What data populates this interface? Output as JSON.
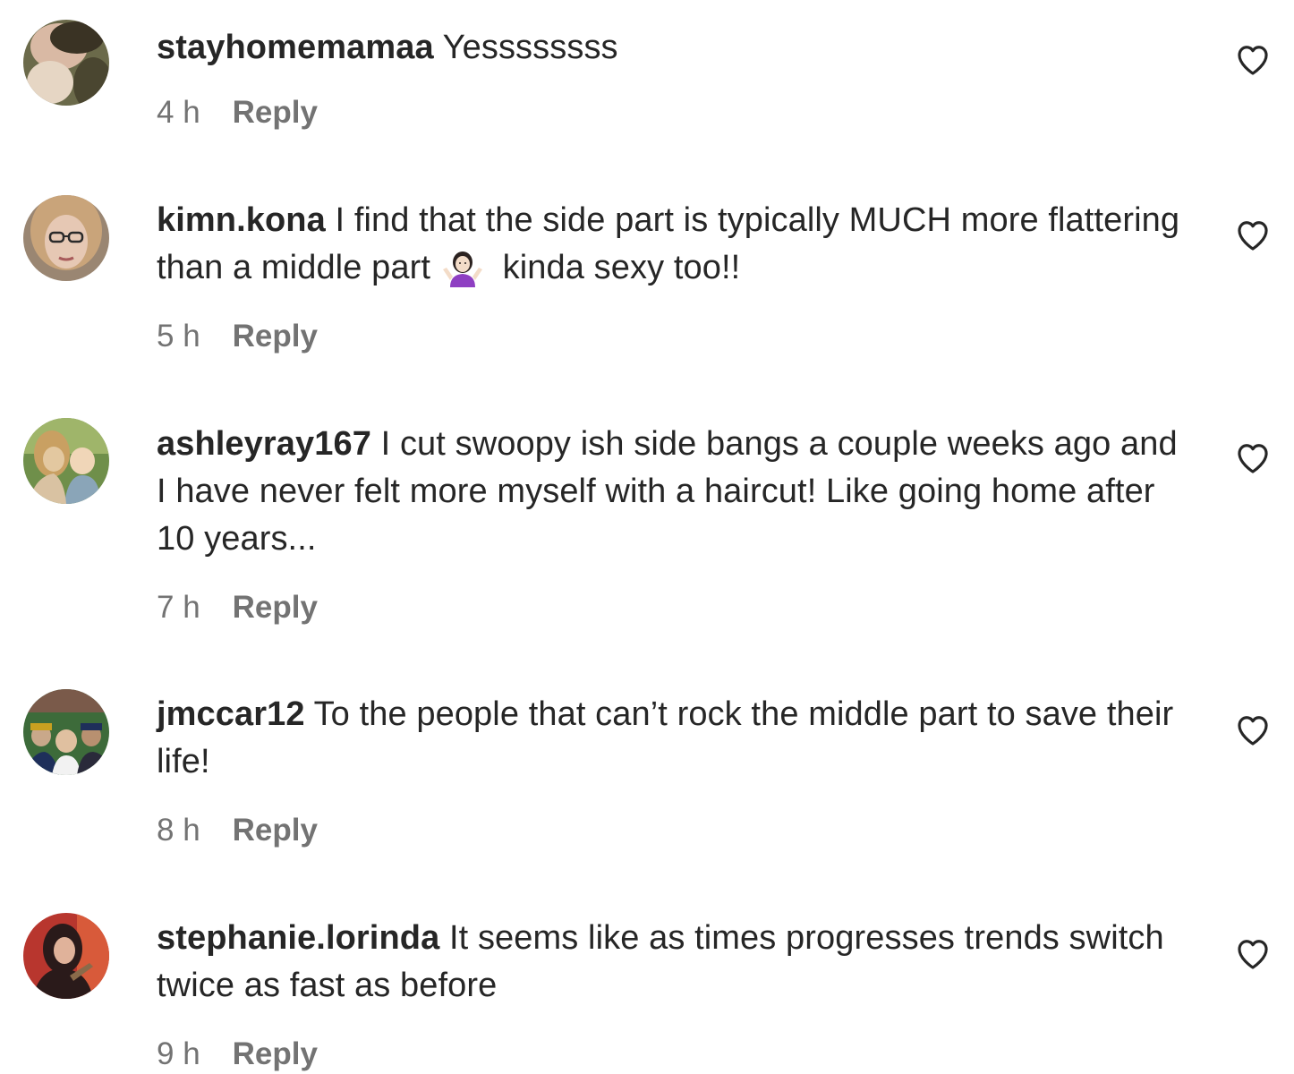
{
  "comments": [
    {
      "username": "stayhomemamaa",
      "text": " Yessssssss",
      "time": "4 h",
      "reply": "Reply",
      "avatar_colors": [
        "#6b6a4a",
        "#d9b9a4",
        "#3a3324"
      ]
    },
    {
      "username": "kimn.kona",
      "text": " I find that the side part is typically MUCH more flattering than a middle part",
      "emoji": "person-shrugging-emoji",
      "text_after": " kinda sexy too!!",
      "time": "5 h",
      "reply": "Reply",
      "avatar_colors": [
        "#9a8672",
        "#e6c8b4",
        "#5a4a3a"
      ]
    },
    {
      "username": "ashleyray167",
      "text": " I cut swoopy ish side bangs a couple weeks ago and I have never felt more myself with a haircut! Like going home after 10 years...",
      "time": "7 h",
      "reply": "Reply",
      "avatar_colors": [
        "#6f8f4a",
        "#e3c8a0",
        "#8aa5b8"
      ]
    },
    {
      "username": "jmccar12",
      "text": " To the people that can’t rock the middle part to save their life!",
      "time": "8 h",
      "reply": "Reply",
      "avatar_colors": [
        "#3d6b3a",
        "#c9a88a",
        "#1e2f5a"
      ]
    },
    {
      "username": "stephanie.lorinda",
      "text": " It seems like as times progresses trends switch twice as fast as before",
      "time": "9 h",
      "reply": "Reply",
      "avatar_colors": [
        "#b8362e",
        "#2a1a1a",
        "#e0b29a"
      ]
    }
  ],
  "icons": {
    "like": "heart-outline-icon"
  },
  "colors": {
    "text": "#262626",
    "secondary": "#737373",
    "background": "#ffffff"
  }
}
